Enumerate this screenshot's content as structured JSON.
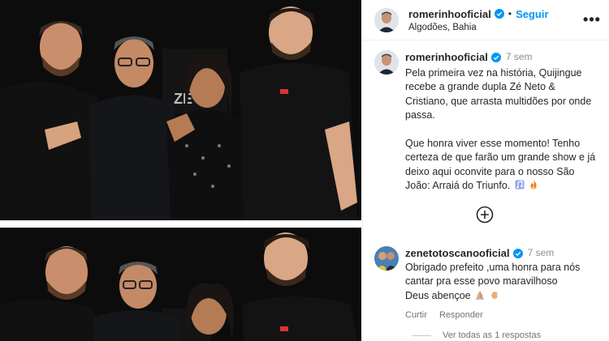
{
  "post": {
    "author": "romerinhooficial",
    "follow_label": "Seguir",
    "location": "Algodões, Bahia",
    "more_label": "•••"
  },
  "caption": {
    "author": "romerinhooficial",
    "time": "7 sem",
    "paragraph1": "Pela primeira vez na história, Quijingue recebe a grande dupla Zé Neto & Cristiano, que arrasta multidões por onde passa.",
    "paragraph2": "Que honra viver esse momento! Tenho certeza de que farão um grande show e já deixo aqui oconvite para o nosso São João: Arraiá do Triunfo."
  },
  "reply": {
    "author": "zenetotoscanooficial",
    "time": "7 sem",
    "line1": "Obrigado prefeito ,uma honra para nós cantar pra esse povo maravilhoso",
    "line2": "Deus abençoe",
    "like_label": "Curtir",
    "reply_label": "Responder",
    "view_replies": "Ver todas as 1 respostas"
  },
  "photo_text": {
    "logo": "ZÉ"
  },
  "colors": {
    "accent": "#0095f6",
    "verified": "#0095f6",
    "muted": "#8e8e8e",
    "photo_bg": "#0b0b0b"
  },
  "icons": [
    "verified-badge-icon",
    "more-icon",
    "plus-circle-icon",
    "music-notes-icon",
    "fire-icon",
    "praying-hands-icon",
    "clapping-hands-icon"
  ]
}
